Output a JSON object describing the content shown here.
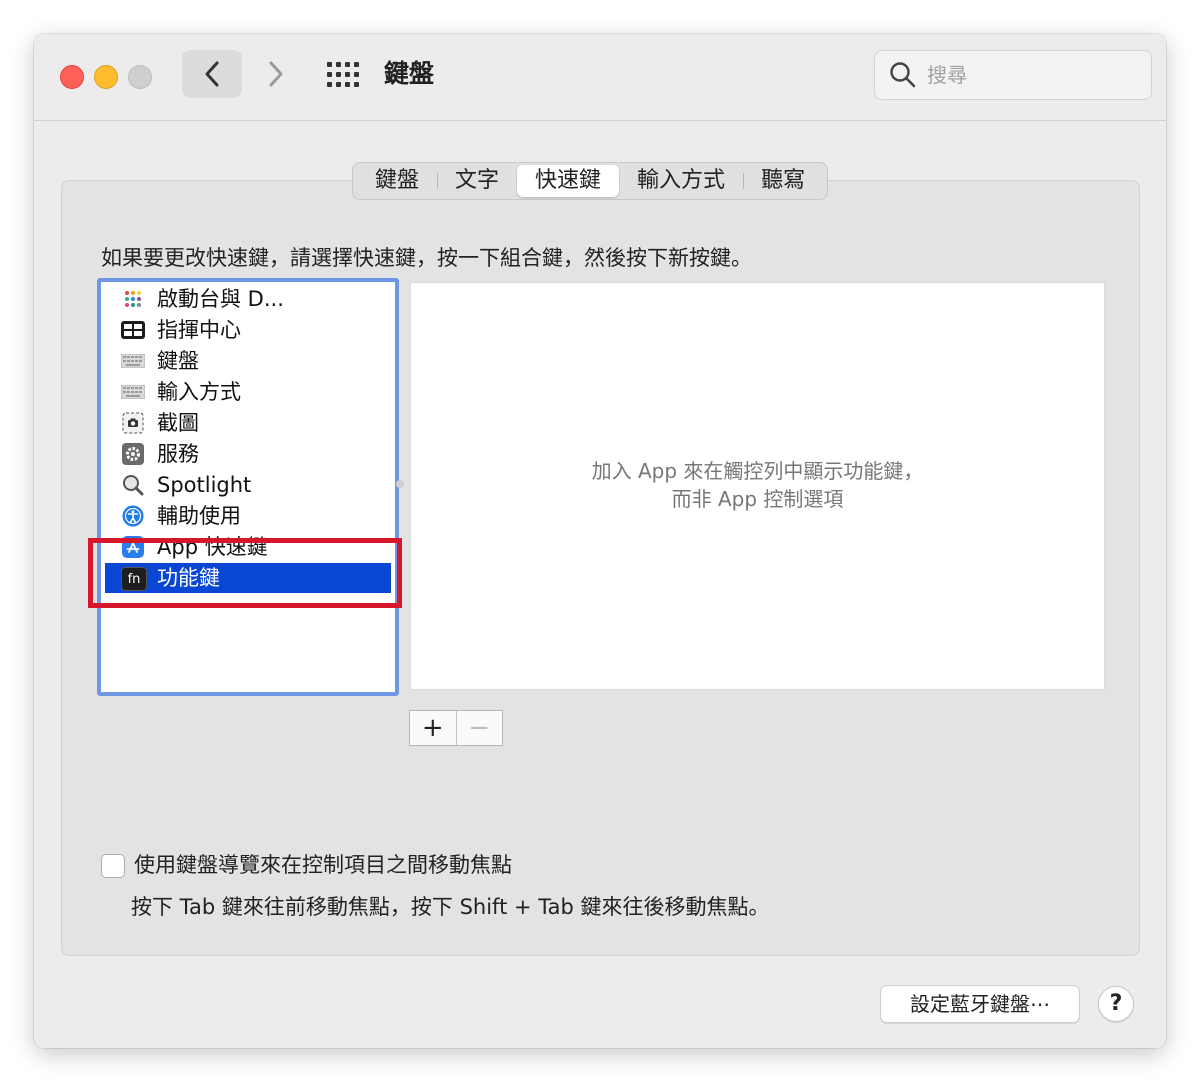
{
  "window": {
    "title": "鍵盤"
  },
  "search": {
    "placeholder": "搜尋"
  },
  "tabs": [
    {
      "label": "鍵盤"
    },
    {
      "label": "文字"
    },
    {
      "label": "快速鍵",
      "active": true
    },
    {
      "label": "輸入方式"
    },
    {
      "label": "聽寫"
    }
  ],
  "instruction": "如果要更改快速鍵，請選擇快速鍵，按一下組合鍵，然後按下新按鍵。",
  "categories": [
    {
      "label": "啟動台與 D...",
      "icon": "launchpad-icon"
    },
    {
      "label": "指揮中心",
      "icon": "mission-control-icon"
    },
    {
      "label": "鍵盤",
      "icon": "keyboard-icon"
    },
    {
      "label": "輸入方式",
      "icon": "input-sources-icon"
    },
    {
      "label": "截圖",
      "icon": "screenshot-icon"
    },
    {
      "label": "服務",
      "icon": "services-gear-icon"
    },
    {
      "label": "Spotlight",
      "icon": "spotlight-icon"
    },
    {
      "label": "輔助使用",
      "icon": "accessibility-icon"
    },
    {
      "label": "App 快速鍵",
      "icon": "app-store-icon"
    },
    {
      "label": "功能鍵",
      "icon": "fn-key-icon",
      "icon_text": "fn",
      "selected": true
    }
  ],
  "detail": {
    "line1": "加入 App 來在觸控列中顯示功能鍵，",
    "line2": "而非 App 控制選項"
  },
  "buttons": {
    "add": "+",
    "remove": "−",
    "bluetooth": "設定藍牙鍵盤⋯",
    "help": "?"
  },
  "keyboard_nav": {
    "checkbox_label": "使用鍵盤導覽來在控制項目之間移動焦點",
    "checked": false,
    "hint": "按下 Tab 鍵來往前移動焦點，按下 Shift + Tab 鍵來往後移動焦點。"
  },
  "colors": {
    "selection": "#0a46d4",
    "list_border": "#6f97e6",
    "highlight_box": "#d7152b",
    "close": "#fe5f57",
    "minimize": "#febc2e"
  }
}
